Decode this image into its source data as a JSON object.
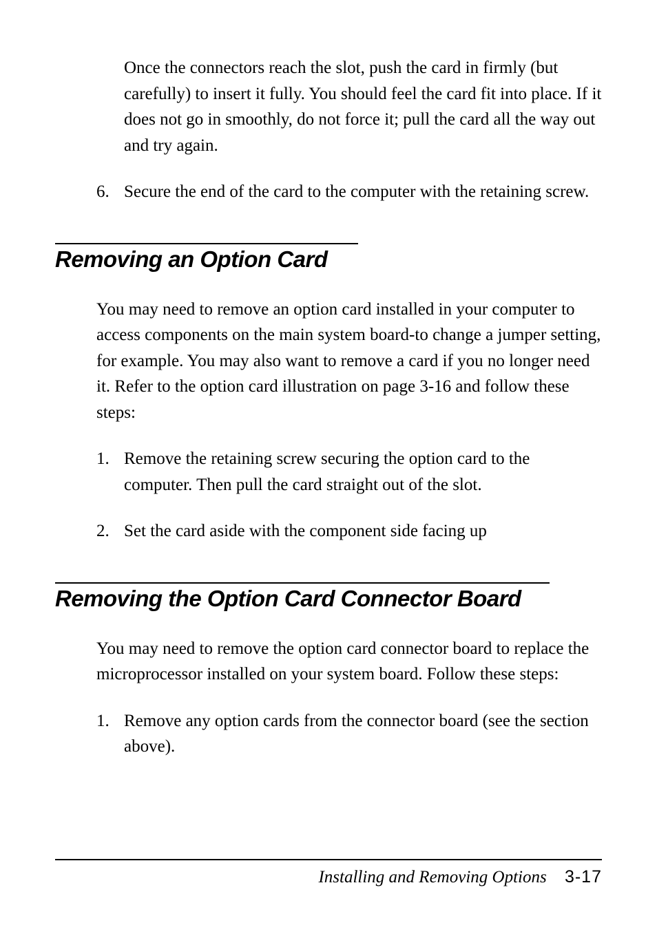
{
  "top": {
    "para1": "Once the connectors reach the slot, push the card in firmly (but carefully) to insert it fully. You should feel the card fit into place. If it does not go in smoothly, do not force it; pull the card all the way out and try again.",
    "item6_num": "6.",
    "item6_text": "Secure the end of the card to the computer with the retaining screw."
  },
  "section1": {
    "heading": "Removing an Option Card",
    "intro": "You may need to remove an option card installed in your computer to access components on the main system board-to change a jumper setting, for example. You may also want to remove a card if you no longer need it. Refer to the option card illustration on page 3-16 and follow these steps:",
    "item1_num": "1.",
    "item1_text": "Remove the retaining screw securing the option card to the computer. Then pull the card straight out of the slot.",
    "item2_num": "2.",
    "item2_text": "Set the card aside with the component side facing up"
  },
  "section2": {
    "heading": "Removing the Option Card Connector Board",
    "intro": "You may need to remove the option card connector board to replace the microprocessor installed on your system board. Follow  these  steps:",
    "item1_num": "1.",
    "item1_text": "Remove any option cards from the connector board (see the section  above)."
  },
  "footer": {
    "title": "Installing and Removing Options",
    "page": "3-17"
  }
}
